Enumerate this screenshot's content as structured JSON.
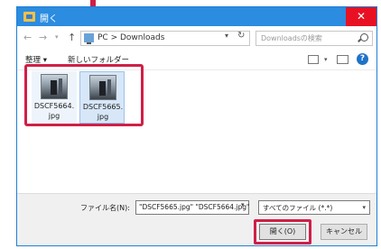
{
  "dialog": {
    "title": "開く",
    "close_glyph": "✕"
  },
  "nav": {
    "back_glyph": "←",
    "forward_glyph": "→",
    "recent_glyph": "▾",
    "up_glyph": "↑",
    "address": "PC > Downloads",
    "address_drop_glyph": "▾",
    "refresh_glyph": "↻",
    "search_placeholder": "Downloadsの検索"
  },
  "toolbar": {
    "organize_label": "整理 ▾",
    "new_folder_label": "新しいフォルダー",
    "views_drop_glyph": "▾",
    "help_glyph": "?"
  },
  "files": [
    {
      "name": "DSCF5664.jpg",
      "selected": false
    },
    {
      "name": "DSCF5665.jpg",
      "selected": true
    }
  ],
  "footer": {
    "filename_label": "ファイル名(N):",
    "filename_value": "\"DSCF5665.jpg\" \"DSCF5664.jpg\"",
    "filename_drop_glyph": "▾",
    "filetype_value": "すべてのファイル (*.*)",
    "filetype_drop_glyph": "▾",
    "open_label": "開く(O)",
    "cancel_label": "キャンセル"
  },
  "colors": {
    "titlebar": "#2b8ce0",
    "close_button": "#e81123",
    "annotation_red": "#d01f46",
    "selected_item": "#d7e7f8"
  }
}
